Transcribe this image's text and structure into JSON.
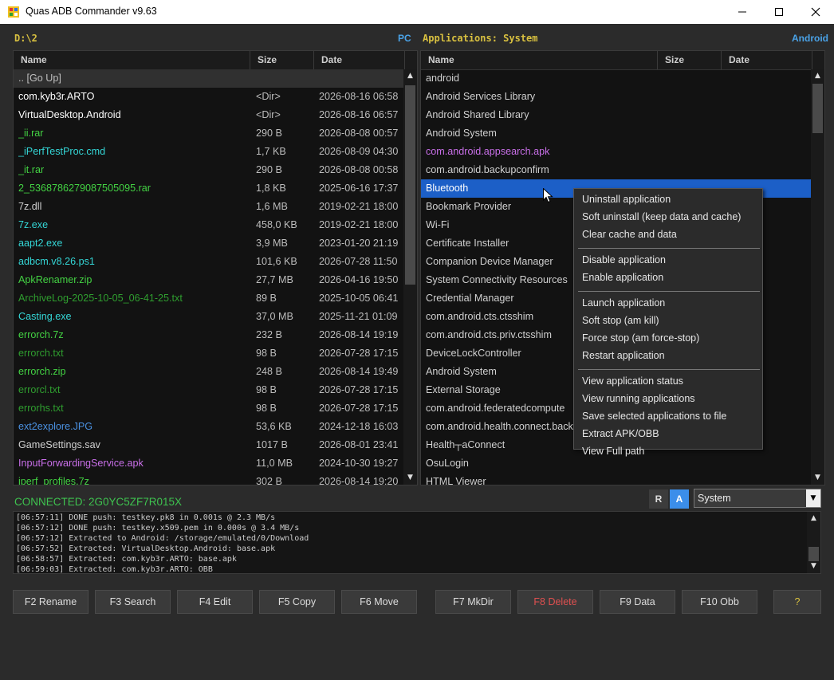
{
  "window": {
    "title": "Quas ADB Commander v9.63",
    "minimize": "—",
    "maximize": "☐",
    "close": "✕"
  },
  "left_panel": {
    "path": "D:\\2",
    "side": "PC",
    "columns": [
      "Name",
      "Size",
      "Date"
    ],
    "rows": [
      {
        "name": ".. [Go Up]",
        "size": "",
        "date": "",
        "color": "#bfbfbf"
      },
      {
        "name": "com.kyb3r.ARTO",
        "size": "<Dir>",
        "date": "2026-08-16 06:58",
        "color": "#ffffff"
      },
      {
        "name": "VirtualDesktop.Android",
        "size": "<Dir>",
        "date": "2026-08-16 06:57",
        "color": "#ffffff"
      },
      {
        "name": "_ii.rar",
        "size": "290 B",
        "date": "2026-08-08 00:57",
        "color": "#43d243"
      },
      {
        "name": "_iPerfTestProc.cmd",
        "size": "1,7 KB",
        "date": "2026-08-09 04:30",
        "color": "#34d6d6"
      },
      {
        "name": "_it.rar",
        "size": "290 B",
        "date": "2026-08-08 00:58",
        "color": "#43d243"
      },
      {
        "name": "2_5368786279087505095.rar",
        "size": "1,8 KB",
        "date": "2025-06-16 17:37",
        "color": "#43d243"
      },
      {
        "name": "7z.dll",
        "size": "1,6 MB",
        "date": "2019-02-21 18:00",
        "color": "#d0d0d0"
      },
      {
        "name": "7z.exe",
        "size": "458,0 KB",
        "date": "2019-02-21 18:00",
        "color": "#34d6d6"
      },
      {
        "name": "aapt2.exe",
        "size": "3,9 MB",
        "date": "2023-01-20 21:19",
        "color": "#34d6d6"
      },
      {
        "name": "adbcm.v8.26.ps1",
        "size": "101,6 KB",
        "date": "2026-07-28 11:50",
        "color": "#34d6d6"
      },
      {
        "name": "ApkRenamer.zip",
        "size": "27,7 MB",
        "date": "2026-04-16 19:50",
        "color": "#43d243"
      },
      {
        "name": "ArchiveLog-2025-10-05_06-41-25.txt",
        "size": "89 B",
        "date": "2025-10-05 06:41",
        "color": "#2f9e2f"
      },
      {
        "name": "Casting.exe",
        "size": "37,0 MB",
        "date": "2025-11-21 01:09",
        "color": "#34d6d6"
      },
      {
        "name": "errorch.7z",
        "size": "232 B",
        "date": "2026-08-14 19:19",
        "color": "#43d243"
      },
      {
        "name": "errorch.txt",
        "size": "98 B",
        "date": "2026-07-28 17:15",
        "color": "#2f9e2f"
      },
      {
        "name": "errorch.zip",
        "size": "248 B",
        "date": "2026-08-14 19:49",
        "color": "#43d243"
      },
      {
        "name": "errorcl.txt",
        "size": "98 B",
        "date": "2026-07-28 17:15",
        "color": "#2f9e2f"
      },
      {
        "name": "errorhs.txt",
        "size": "98 B",
        "date": "2026-07-28 17:15",
        "color": "#2f9e2f"
      },
      {
        "name": "ext2explore.JPG",
        "size": "53,6 KB",
        "date": "2024-12-18 16:03",
        "color": "#4a90e0"
      },
      {
        "name": "GameSettings.sav",
        "size": "1017 B",
        "date": "2026-08-01 23:41",
        "color": "#d0d0d0"
      },
      {
        "name": "InputForwardingService.apk",
        "size": "11,0 MB",
        "date": "2024-10-30 19:27",
        "color": "#c86fe8"
      },
      {
        "name": "iperf_profiles.7z",
        "size": "302 B",
        "date": "2026-08-14 19:20",
        "color": "#43d243"
      }
    ]
  },
  "right_panel": {
    "path": "Applications: System",
    "side": "Android",
    "columns": [
      "Name",
      "Size",
      "Date"
    ],
    "rows": [
      {
        "name": "android",
        "color": "#d0d0d0"
      },
      {
        "name": "Android Services Library",
        "color": "#d0d0d0"
      },
      {
        "name": "Android Shared Library",
        "color": "#d0d0d0"
      },
      {
        "name": "Android System",
        "color": "#d0d0d0"
      },
      {
        "name": "com.android.appsearch.apk",
        "color": "#c86fe8"
      },
      {
        "name": "com.android.backupconfirm",
        "color": "#d0d0d0"
      },
      {
        "name": "Bluetooth",
        "color": "#ffffff",
        "selected": true
      },
      {
        "name": "Bookmark Provider",
        "color": "#d0d0d0"
      },
      {
        "name": "Wi-Fi",
        "color": "#d0d0d0"
      },
      {
        "name": "Certificate Installer",
        "color": "#d0d0d0"
      },
      {
        "name": "Companion Device Manager",
        "color": "#d0d0d0"
      },
      {
        "name": "System Connectivity Resources",
        "color": "#d0d0d0"
      },
      {
        "name": "Credential Manager",
        "color": "#d0d0d0"
      },
      {
        "name": "com.android.cts.ctsshim",
        "color": "#d0d0d0"
      },
      {
        "name": "com.android.cts.priv.ctsshim",
        "color": "#d0d0d0"
      },
      {
        "name": "DeviceLockController",
        "color": "#d0d0d0"
      },
      {
        "name": "Android System",
        "color": "#d0d0d0"
      },
      {
        "name": "External Storage",
        "color": "#d0d0d0"
      },
      {
        "name": "com.android.federatedcompute",
        "color": "#d0d0d0"
      },
      {
        "name": "com.android.health.connect.backup",
        "color": "#d0d0d0"
      },
      {
        "name": "Health┬aConnect",
        "color": "#d0d0d0"
      },
      {
        "name": "OsuLogin",
        "color": "#d0d0d0"
      },
      {
        "name": "HTML Viewer",
        "color": "#d0d0d0"
      }
    ]
  },
  "context_menu": {
    "groups": [
      [
        "Uninstall application",
        "Soft uninstall (keep data and cache)",
        "Clear cache and data"
      ],
      [
        "Disable application",
        "Enable application"
      ],
      [
        "Launch application",
        "Soft stop (am kill)",
        "Force stop (am force-stop)",
        "Restart application"
      ],
      [
        "View application status",
        "View running applications",
        "Save selected applications to file",
        "Extract APK/OBB",
        "View Full path"
      ]
    ]
  },
  "status": {
    "connected": "CONNECTED: 2G0YC5ZF7R015X",
    "r_label": "R",
    "a_label": "A",
    "filter": "System"
  },
  "log": [
    "[06:57:11] DONE push: testkey.pk8  in 0.001s  @ 2.3 MB/s",
    "[06:57:12] DONE push: testkey.x509.pem  in 0.000s  @ 3.4 MB/s",
    "[06:57:12] Extracted to Android: /storage/emulated/0/Download",
    "[06:57:52] Extracted: VirtualDesktop.Android: base.apk",
    "[06:58:57] Extracted: com.kyb3r.ARTO: base.apk",
    "[06:59:03] Extracted: com.kyb3r.ARTO: OBB"
  ],
  "function_keys": [
    {
      "label": "F2 Rename",
      "color": "#dddddd"
    },
    {
      "label": "F3 Search",
      "color": "#dddddd"
    },
    {
      "label": "F4 Edit",
      "color": "#dddddd"
    },
    {
      "label": "F5 Copy",
      "color": "#dddddd"
    },
    {
      "label": "F6 Move",
      "color": "#dddddd"
    },
    {
      "label": "F7 MkDir",
      "color": "#dddddd"
    },
    {
      "label": "F8 Delete",
      "color": "#e05050"
    },
    {
      "label": "F9 Data",
      "color": "#dddddd"
    },
    {
      "label": "F10 Obb",
      "color": "#dddddd"
    },
    {
      "label": "?",
      "color": "#d8c040"
    }
  ],
  "colors": {
    "accent": "#4aa3e8",
    "selection": "#1c5fc7",
    "path": "#d8c040",
    "connected": "#3ec24f"
  }
}
